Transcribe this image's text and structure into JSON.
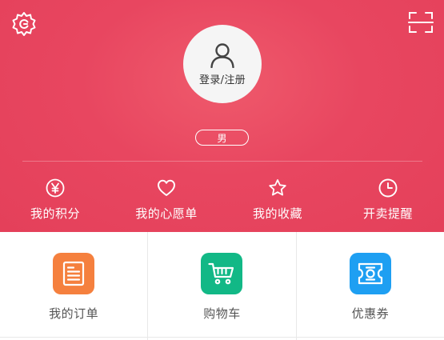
{
  "header": {
    "login_label": "登录/注册",
    "gender": "男",
    "icons": {
      "settings": "settings-icon",
      "scan": "scan-icon",
      "avatar": "user-icon"
    }
  },
  "stats": [
    {
      "label": "我的积分",
      "icon": "yen-icon"
    },
    {
      "label": "我的心愿单",
      "icon": "heart-icon"
    },
    {
      "label": "我的收藏",
      "icon": "star-icon"
    },
    {
      "label": "开卖提醒",
      "icon": "clock-icon"
    }
  ],
  "tiles": [
    {
      "label": "我的订单",
      "icon": "order-list-icon",
      "color": "#f5803e"
    },
    {
      "label": "购物车",
      "icon": "cart-icon",
      "color": "#12b886"
    },
    {
      "label": "优惠券",
      "icon": "coupon-icon",
      "color": "#1e9ff2"
    }
  ],
  "colors": {
    "header_bg": "#e8465f",
    "accent_orange": "#f5803e",
    "accent_green": "#12b886",
    "accent_blue": "#1e9ff2"
  }
}
